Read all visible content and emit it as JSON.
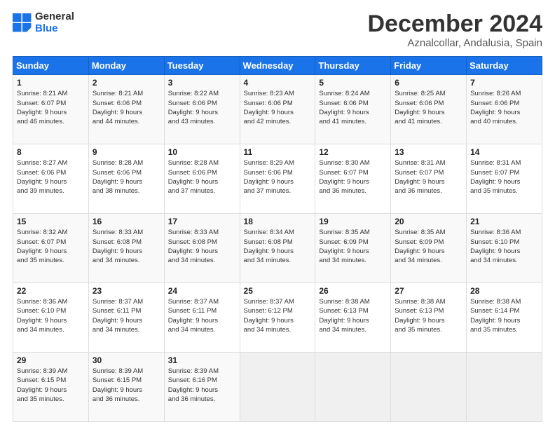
{
  "logo": {
    "line1": "General",
    "line2": "Blue"
  },
  "title": "December 2024",
  "location": "Aznalcollar, Andalusia, Spain",
  "weekdays": [
    "Sunday",
    "Monday",
    "Tuesday",
    "Wednesday",
    "Thursday",
    "Friday",
    "Saturday"
  ],
  "weeks": [
    [
      {
        "day": "1",
        "lines": [
          "Sunrise: 8:21 AM",
          "Sunset: 6:07 PM",
          "Daylight: 9 hours",
          "and 46 minutes."
        ]
      },
      {
        "day": "2",
        "lines": [
          "Sunrise: 8:21 AM",
          "Sunset: 6:06 PM",
          "Daylight: 9 hours",
          "and 44 minutes."
        ]
      },
      {
        "day": "3",
        "lines": [
          "Sunrise: 8:22 AM",
          "Sunset: 6:06 PM",
          "Daylight: 9 hours",
          "and 43 minutes."
        ]
      },
      {
        "day": "4",
        "lines": [
          "Sunrise: 8:23 AM",
          "Sunset: 6:06 PM",
          "Daylight: 9 hours",
          "and 42 minutes."
        ]
      },
      {
        "day": "5",
        "lines": [
          "Sunrise: 8:24 AM",
          "Sunset: 6:06 PM",
          "Daylight: 9 hours",
          "and 41 minutes."
        ]
      },
      {
        "day": "6",
        "lines": [
          "Sunrise: 8:25 AM",
          "Sunset: 6:06 PM",
          "Daylight: 9 hours",
          "and 41 minutes."
        ]
      },
      {
        "day": "7",
        "lines": [
          "Sunrise: 8:26 AM",
          "Sunset: 6:06 PM",
          "Daylight: 9 hours",
          "and 40 minutes."
        ]
      }
    ],
    [
      {
        "day": "8",
        "lines": [
          "Sunrise: 8:27 AM",
          "Sunset: 6:06 PM",
          "Daylight: 9 hours",
          "and 39 minutes."
        ]
      },
      {
        "day": "9",
        "lines": [
          "Sunrise: 8:28 AM",
          "Sunset: 6:06 PM",
          "Daylight: 9 hours",
          "and 38 minutes."
        ]
      },
      {
        "day": "10",
        "lines": [
          "Sunrise: 8:28 AM",
          "Sunset: 6:06 PM",
          "Daylight: 9 hours",
          "and 37 minutes."
        ]
      },
      {
        "day": "11",
        "lines": [
          "Sunrise: 8:29 AM",
          "Sunset: 6:06 PM",
          "Daylight: 9 hours",
          "and 37 minutes."
        ]
      },
      {
        "day": "12",
        "lines": [
          "Sunrise: 8:30 AM",
          "Sunset: 6:07 PM",
          "Daylight: 9 hours",
          "and 36 minutes."
        ]
      },
      {
        "day": "13",
        "lines": [
          "Sunrise: 8:31 AM",
          "Sunset: 6:07 PM",
          "Daylight: 9 hours",
          "and 36 minutes."
        ]
      },
      {
        "day": "14",
        "lines": [
          "Sunrise: 8:31 AM",
          "Sunset: 6:07 PM",
          "Daylight: 9 hours",
          "and 35 minutes."
        ]
      }
    ],
    [
      {
        "day": "15",
        "lines": [
          "Sunrise: 8:32 AM",
          "Sunset: 6:07 PM",
          "Daylight: 9 hours",
          "and 35 minutes."
        ]
      },
      {
        "day": "16",
        "lines": [
          "Sunrise: 8:33 AM",
          "Sunset: 6:08 PM",
          "Daylight: 9 hours",
          "and 34 minutes."
        ]
      },
      {
        "day": "17",
        "lines": [
          "Sunrise: 8:33 AM",
          "Sunset: 6:08 PM",
          "Daylight: 9 hours",
          "and 34 minutes."
        ]
      },
      {
        "day": "18",
        "lines": [
          "Sunrise: 8:34 AM",
          "Sunset: 6:08 PM",
          "Daylight: 9 hours",
          "and 34 minutes."
        ]
      },
      {
        "day": "19",
        "lines": [
          "Sunrise: 8:35 AM",
          "Sunset: 6:09 PM",
          "Daylight: 9 hours",
          "and 34 minutes."
        ]
      },
      {
        "day": "20",
        "lines": [
          "Sunrise: 8:35 AM",
          "Sunset: 6:09 PM",
          "Daylight: 9 hours",
          "and 34 minutes."
        ]
      },
      {
        "day": "21",
        "lines": [
          "Sunrise: 8:36 AM",
          "Sunset: 6:10 PM",
          "Daylight: 9 hours",
          "and 34 minutes."
        ]
      }
    ],
    [
      {
        "day": "22",
        "lines": [
          "Sunrise: 8:36 AM",
          "Sunset: 6:10 PM",
          "Daylight: 9 hours",
          "and 34 minutes."
        ]
      },
      {
        "day": "23",
        "lines": [
          "Sunrise: 8:37 AM",
          "Sunset: 6:11 PM",
          "Daylight: 9 hours",
          "and 34 minutes."
        ]
      },
      {
        "day": "24",
        "lines": [
          "Sunrise: 8:37 AM",
          "Sunset: 6:11 PM",
          "Daylight: 9 hours",
          "and 34 minutes."
        ]
      },
      {
        "day": "25",
        "lines": [
          "Sunrise: 8:37 AM",
          "Sunset: 6:12 PM",
          "Daylight: 9 hours",
          "and 34 minutes."
        ]
      },
      {
        "day": "26",
        "lines": [
          "Sunrise: 8:38 AM",
          "Sunset: 6:13 PM",
          "Daylight: 9 hours",
          "and 34 minutes."
        ]
      },
      {
        "day": "27",
        "lines": [
          "Sunrise: 8:38 AM",
          "Sunset: 6:13 PM",
          "Daylight: 9 hours",
          "and 35 minutes."
        ]
      },
      {
        "day": "28",
        "lines": [
          "Sunrise: 8:38 AM",
          "Sunset: 6:14 PM",
          "Daylight: 9 hours",
          "and 35 minutes."
        ]
      }
    ],
    [
      {
        "day": "29",
        "lines": [
          "Sunrise: 8:39 AM",
          "Sunset: 6:15 PM",
          "Daylight: 9 hours",
          "and 35 minutes."
        ]
      },
      {
        "day": "30",
        "lines": [
          "Sunrise: 8:39 AM",
          "Sunset: 6:15 PM",
          "Daylight: 9 hours",
          "and 36 minutes."
        ]
      },
      {
        "day": "31",
        "lines": [
          "Sunrise: 8:39 AM",
          "Sunset: 6:16 PM",
          "Daylight: 9 hours",
          "and 36 minutes."
        ]
      },
      {
        "day": "",
        "lines": []
      },
      {
        "day": "",
        "lines": []
      },
      {
        "day": "",
        "lines": []
      },
      {
        "day": "",
        "lines": []
      }
    ]
  ]
}
